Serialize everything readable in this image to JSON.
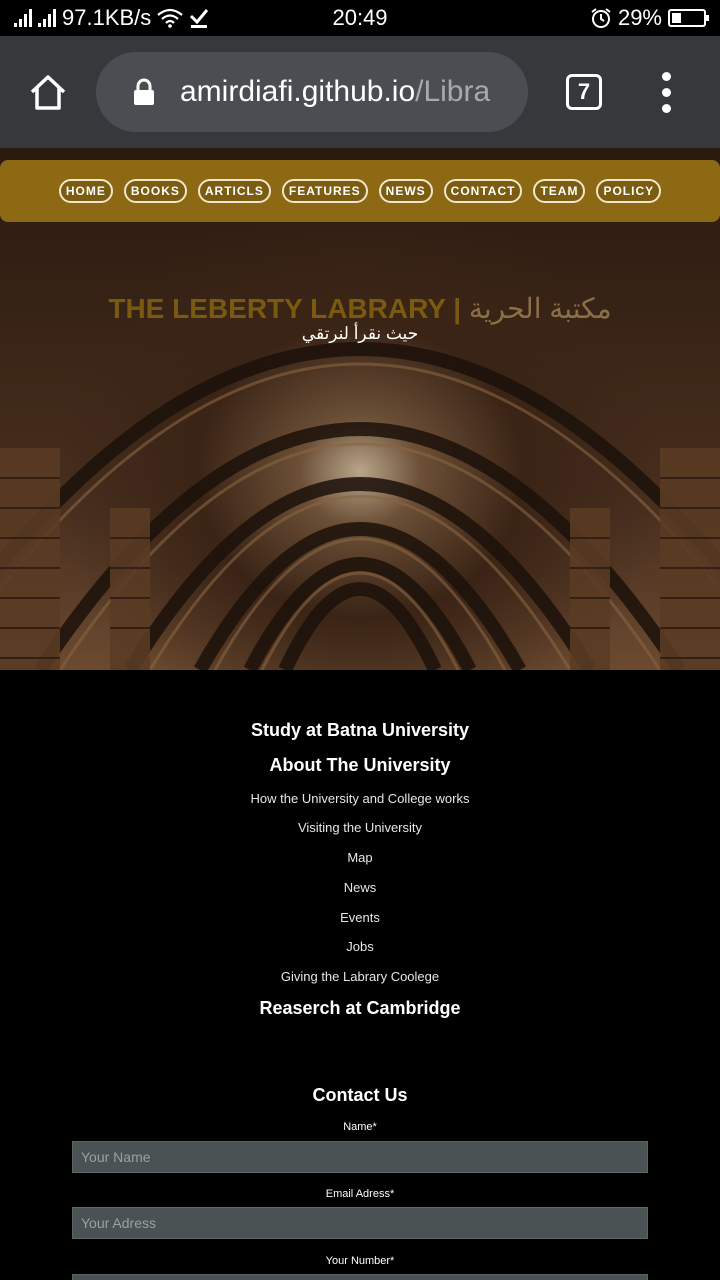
{
  "status_bar": {
    "speed": "97.1KB/s",
    "time": "20:49",
    "battery": "29%",
    "battery_level": 0.29
  },
  "browser": {
    "url_host": "amirdiafi.github.io",
    "url_path": "/Libra",
    "tab_count": "7"
  },
  "nav": {
    "items": [
      "HOME",
      "BOOKS",
      "ARTICLS",
      "FEATURES",
      "NEWS",
      "CONTACT",
      "TEAM",
      "POLICY"
    ]
  },
  "hero": {
    "title_en": "THE LEBERTY LABRARY",
    "separator": "|",
    "title_ar": "مكتبة الحرية",
    "subtitle": "حيث نقرأ لنرتقي"
  },
  "footer": {
    "heading_study": "Study at Batna University",
    "heading_about": "About The University",
    "links": [
      "How the University and College works",
      "Visiting the University",
      "Map",
      "News",
      "Events",
      "Jobs",
      "Giving the Labrary Coolege"
    ],
    "heading_research": "Reaserch at Cambridge",
    "contact_heading": "Contact Us",
    "name_label": "Name*",
    "name_placeholder": "Your Name",
    "email_label": "Email Adress*",
    "email_placeholder": "Your Adress",
    "number_label": "Your Number*"
  }
}
